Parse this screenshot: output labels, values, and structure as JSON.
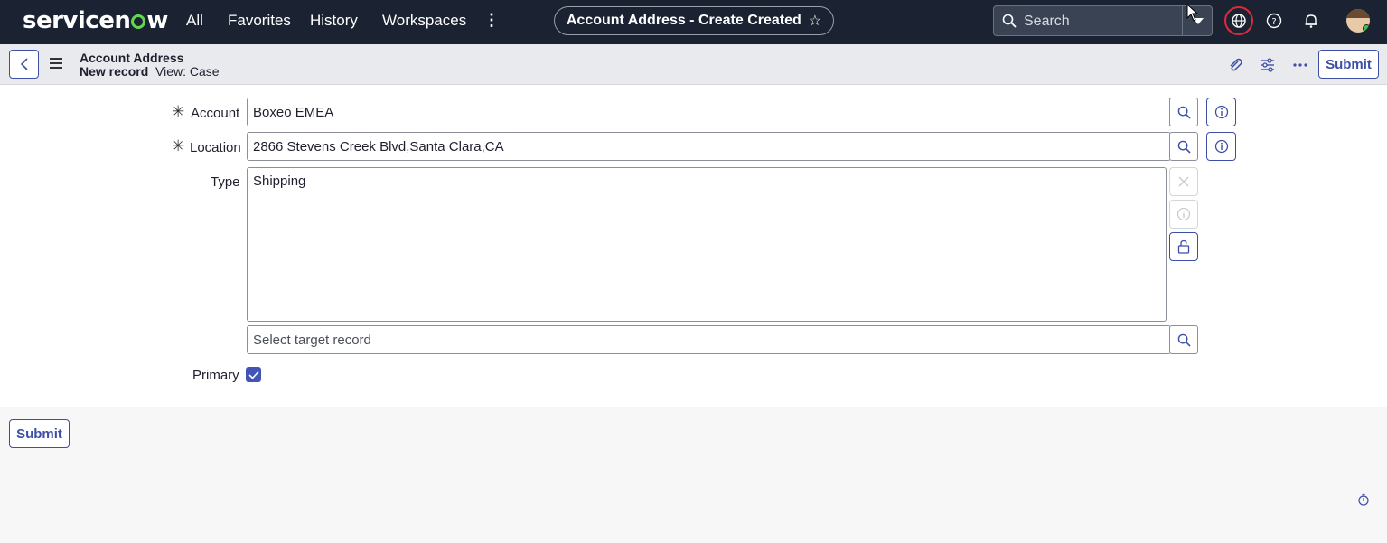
{
  "nav": {
    "logo_pre": "servicen",
    "logo_post": "w",
    "links": [
      "All",
      "Favorites",
      "History",
      "Workspaces"
    ],
    "page_title": "Account Address - Create Created",
    "search_placeholder": "Search"
  },
  "header": {
    "record_table": "Account Address",
    "record_state": "New record",
    "view_label": "View: Case",
    "submit_label": "Submit"
  },
  "form": {
    "account": {
      "label": "Account",
      "value": "Boxeo EMEA",
      "required": true
    },
    "location": {
      "label": "Location",
      "value": "2866 Stevens Creek Blvd,Santa Clara,CA",
      "required": true
    },
    "type": {
      "label": "Type",
      "value": "Shipping",
      "target_placeholder": "Select target record"
    },
    "primary": {
      "label": "Primary",
      "checked": true
    }
  },
  "footer": {
    "submit_label": "Submit"
  },
  "colors": {
    "nav_bg": "#1b2332",
    "accent": "#3d4ea7",
    "alert_ring": "#e0283b",
    "brand_green": "#62d84e"
  }
}
